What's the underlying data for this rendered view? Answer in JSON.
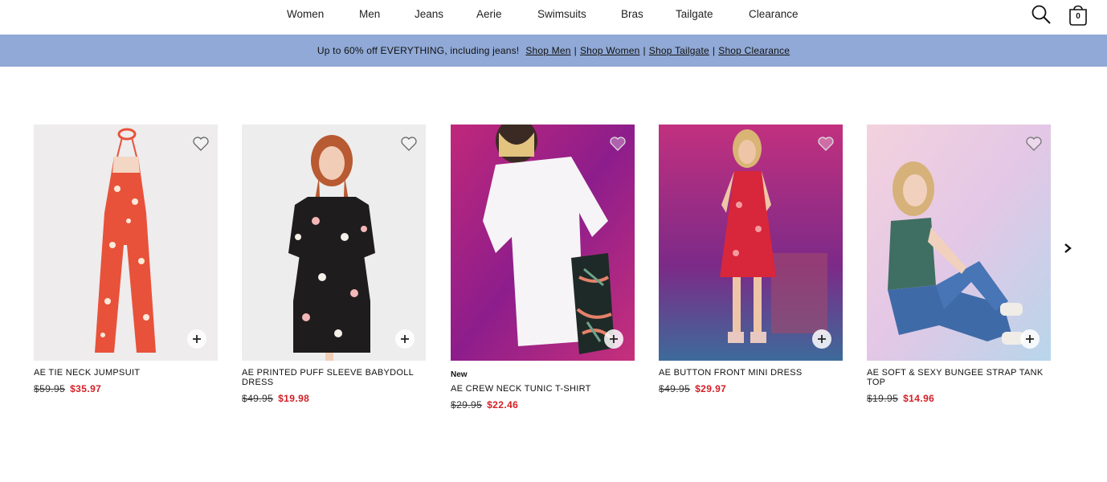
{
  "nav": {
    "links": [
      "Women",
      "Men",
      "Jeans",
      "Aerie",
      "Swimsuits",
      "Bras",
      "Tailgate",
      "Clearance"
    ],
    "bag_count": "0",
    "search_icon": "search-icon",
    "bag_icon": "bag-icon"
  },
  "promo": {
    "text": "Up to 60% off EVERYTHING, including jeans!",
    "links": [
      "Shop Men",
      "Shop Women",
      "Shop Tailgate",
      "Shop Clearance"
    ],
    "background": "#90a9d6"
  },
  "products": [
    {
      "name": "AE TIE NECK JUMPSUIT",
      "badge": "",
      "was": "$59.95",
      "now": "$35.97"
    },
    {
      "name": "AE PRINTED PUFF SLEEVE BABYDOLL DRESS",
      "badge": "",
      "was": "$49.95",
      "now": "$19.98"
    },
    {
      "name": "AE CREW NECK TUNIC T-SHIRT",
      "badge": "New",
      "was": "$29.95",
      "now": "$22.46"
    },
    {
      "name": "AE BUTTON FRONT MINI DRESS",
      "badge": "",
      "was": "$49.95",
      "now": "$29.97"
    },
    {
      "name": "AE SOFT & SEXY BUNGEE STRAP TANK TOP",
      "badge": "",
      "was": "$19.95",
      "now": "$14.96"
    }
  ],
  "colors": {
    "sale_price": "#d41f26"
  }
}
